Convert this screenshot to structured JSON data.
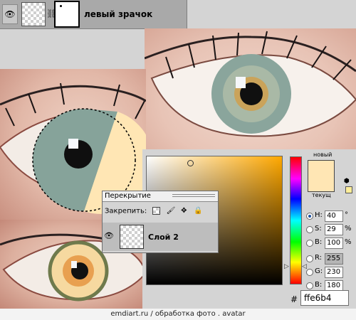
{
  "layer_strip": {
    "layer_name": "левый зрачок"
  },
  "photos": {
    "right_eye": "eye-photo",
    "left_eye": "eye-photo",
    "bottom_eye": "eye-photo"
  },
  "color_picker": {
    "label_new": "новый",
    "label_current": "текущ",
    "new_color": "#ffe6b4",
    "current_color": "#ffe6b4",
    "fields": [
      {
        "id": "h",
        "label": "H:",
        "value": "40",
        "unit": "°",
        "selected": true
      },
      {
        "id": "s",
        "label": "S:",
        "value": "29",
        "unit": "%",
        "selected": false
      },
      {
        "id": "b",
        "label": "B:",
        "value": "100",
        "unit": "%",
        "selected": false
      },
      {
        "id": "r",
        "label": "R:",
        "value": "255",
        "unit": "",
        "selected": false
      },
      {
        "id": "g",
        "label": "G:",
        "value": "230",
        "unit": "",
        "selected": false
      },
      {
        "id": "bb",
        "label": "B:",
        "value": "180",
        "unit": "",
        "selected": false
      }
    ],
    "hash": "#",
    "hex": "ffe6b4"
  },
  "layers_panel": {
    "blend_mode": "Перекрытие",
    "lock_label": "Закрепить:",
    "layer_name": "Слой 2"
  },
  "footer": {
    "text": "emdiart.ru   / обработка фото . avatar"
  }
}
